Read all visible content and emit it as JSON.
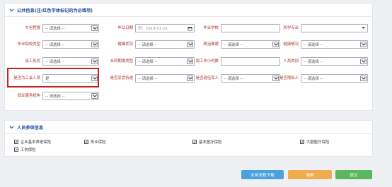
{
  "public_section": {
    "title": "公共信息(注:红色字体标记的为必填项)",
    "rows": [
      [
        {
          "label": "文化程度",
          "kind": "select",
          "value": "-- 请选择 --"
        },
        {
          "label": "毕业日期",
          "kind": "date",
          "value": "例：2019-01-01"
        },
        {
          "label": "毕业学校",
          "kind": "input",
          "value": ""
        },
        {
          "label": "所学专业",
          "kind": "select",
          "value": ""
        }
      ],
      [
        {
          "label": "毕业院校类型",
          "kind": "select",
          "value": "-- 请选择 --"
        },
        {
          "label": "婚姻状况",
          "kind": "select",
          "value": "-- 请选择 --"
        },
        {
          "label": "政治面貌",
          "kind": "select",
          "value": "-- 请选择 --"
        },
        {
          "label": "健康情况",
          "kind": "select",
          "value": "-- 请选择 --"
        }
      ],
      [
        {
          "label": "用工形式",
          "kind": "select",
          "value": "-- 请选择 --"
        },
        {
          "label": "合同期限类型",
          "kind": "select",
          "value": "-- 请选择 --"
        },
        {
          "label": "周工作小时数",
          "kind": "input",
          "value": ""
        },
        {
          "label": "人员类别",
          "kind": "select",
          "value": "-- 请选择 --"
        }
      ],
      [
        {
          "label": "是否为工会人员",
          "kind": "select",
          "value": "是"
        },
        {
          "label": "是否享受待遇",
          "kind": "select",
          "value": "-- 请选择 --"
        },
        {
          "label": "是否退伍军人",
          "kind": "select",
          "value": "-- 请选择 --"
        },
        {
          "label": "是否残疾人",
          "kind": "select",
          "value": "-- 请选择 --"
        }
      ],
      [
        {
          "label": "就业服务机构",
          "kind": "select",
          "value": "-- 请选择 --"
        }
      ]
    ]
  },
  "insurance_section": {
    "title": "人员参保信息",
    "items": [
      "企业基本养老保险",
      "失业保险",
      "基本医疗保险",
      "大额医疗保险",
      "工伤保险"
    ]
  },
  "buttons": {
    "download": "业务流程下载",
    "clear": "清屏",
    "submit": "提交"
  },
  "colors": {
    "download": "#4aa3df",
    "clear": "#f0ad4e",
    "submit": "#5cb85c",
    "required_label": "#a8322d",
    "title": "#1f4e9a",
    "highlight": "#c8231e"
  }
}
